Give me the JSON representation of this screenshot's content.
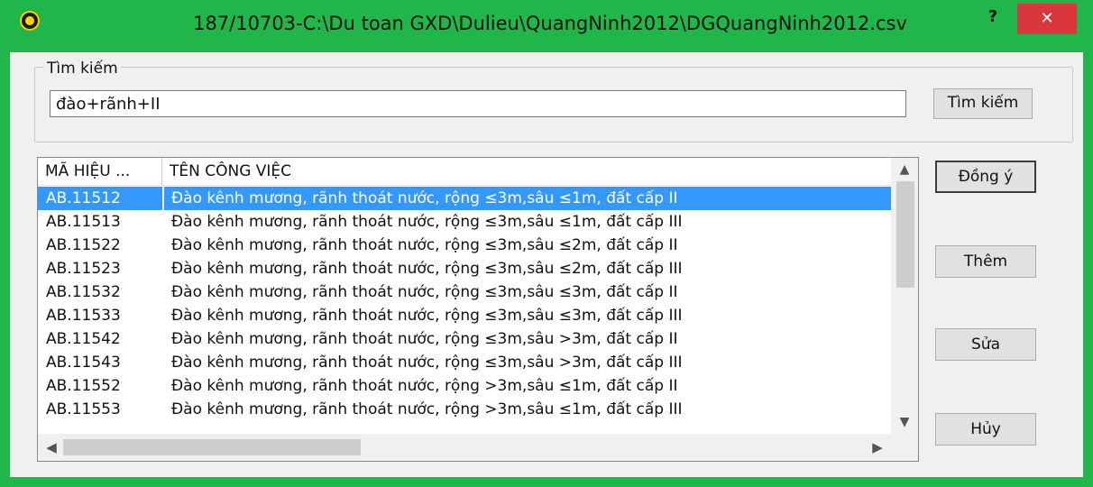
{
  "window": {
    "title": "187/10703-C:\\Du toan GXD\\Dulieu\\QuangNinh2012\\DGQuangNinh2012.csv",
    "help_label": "?",
    "close_label": "✕"
  },
  "search": {
    "group_label": "Tìm kiếm",
    "value": "đào+rãnh+II",
    "button_label": "Tìm kiếm"
  },
  "list": {
    "columns": [
      "MÃ HIỆU ...",
      "TÊN CÔNG VIỆC"
    ],
    "selected_index": 0,
    "rows": [
      {
        "code": "AB.11512",
        "name": "Đào kênh mương, rãnh thoát nước, rộng ≤3m,sâu ≤1m, đất cấp II"
      },
      {
        "code": "AB.11513",
        "name": "Đào kênh mương, rãnh thoát nước, rộng ≤3m,sâu ≤1m, đất cấp III"
      },
      {
        "code": "AB.11522",
        "name": "Đào kênh mương, rãnh thoát nước, rộng ≤3m,sâu ≤2m, đất cấp II"
      },
      {
        "code": "AB.11523",
        "name": "Đào kênh mương, rãnh thoát nước, rộng ≤3m,sâu ≤2m, đất cấp III"
      },
      {
        "code": "AB.11532",
        "name": "Đào kênh mương, rãnh thoát nước, rộng ≤3m,sâu ≤3m, đất cấp II"
      },
      {
        "code": "AB.11533",
        "name": "Đào kênh mương, rãnh thoát nước, rộng ≤3m,sâu ≤3m, đất cấp III"
      },
      {
        "code": "AB.11542",
        "name": "Đào kênh mương, rãnh thoát nước, rộng ≤3m,sâu >3m, đất cấp II"
      },
      {
        "code": "AB.11543",
        "name": "Đào kênh mương, rãnh thoát nước, rộng ≤3m,sâu >3m, đất cấp III"
      },
      {
        "code": "AB.11552",
        "name": "Đào kênh mương, rãnh thoát nước, rộng >3m,sâu ≤1m, đất cấp II"
      },
      {
        "code": "AB.11553",
        "name": "Đào kênh mương, rãnh thoát nước, rộng >3m,sâu ≤1m, đất cấp III"
      }
    ]
  },
  "buttons": {
    "ok": "Đồng ý",
    "add": "Thêm",
    "edit": "Sửa",
    "cancel": "Hủy"
  },
  "scroll_icons": {
    "up": "▲",
    "down": "▼",
    "left": "◀",
    "right": "▶"
  },
  "colors": {
    "frame": "#21b64a",
    "close": "#d9363e",
    "selection": "#3399ff"
  }
}
